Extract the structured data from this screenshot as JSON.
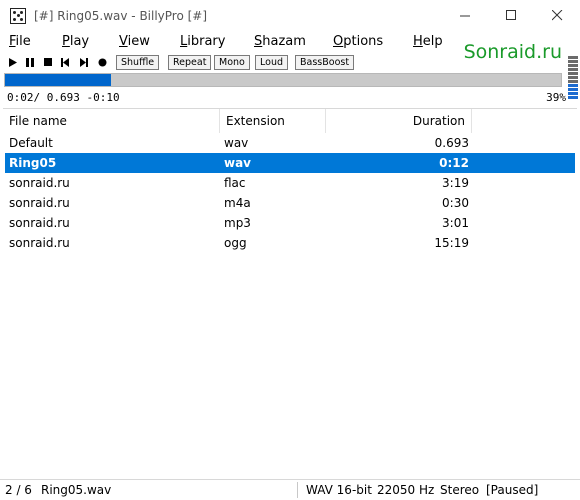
{
  "window": {
    "title": "[#] Ring05.wav - BillyPro [#]",
    "controls": {
      "minimize": "—",
      "maximize": "☐",
      "close": "✕"
    }
  },
  "menu": {
    "items": [
      {
        "label": "File",
        "underline": "F",
        "rest": "ile"
      },
      {
        "label": "Play",
        "underline": "P",
        "rest": "lay"
      },
      {
        "label": "View",
        "underline": "V",
        "rest": "iew"
      },
      {
        "label": "Library",
        "underline": "L",
        "rest": "ibrary"
      },
      {
        "label": "Shazam",
        "underline": "S",
        "rest": "hazam"
      },
      {
        "label": "Options",
        "underline": "O",
        "rest": "ptions"
      },
      {
        "label": "Help",
        "underline": "H",
        "rest": "elp"
      }
    ],
    "brand": "Sonraid.ru"
  },
  "toolbar": {
    "icons": [
      "play-icon",
      "pause-icon",
      "stop-icon",
      "previous-icon",
      "next-icon",
      "record-icon"
    ],
    "buttons": [
      "Shuffle",
      "Repeat",
      "Mono",
      "Loud",
      "BassBoost"
    ]
  },
  "playback": {
    "progress_fraction": 0.19,
    "time_text": "0:02/ 0.693  -0:10",
    "volume_text": "39%"
  },
  "table": {
    "columns": [
      "File name",
      "Extension",
      "Duration"
    ],
    "rows": [
      {
        "name": "Default",
        "ext": "wav",
        "duration": "0.693",
        "selected": false
      },
      {
        "name": "Ring05",
        "ext": "wav",
        "duration": "0:12",
        "selected": true
      },
      {
        "name": "sonraid.ru",
        "ext": "flac",
        "duration": "3:19",
        "selected": false
      },
      {
        "name": "sonraid.ru",
        "ext": "m4a",
        "duration": "0:30",
        "selected": false
      },
      {
        "name": "sonraid.ru",
        "ext": "mp3",
        "duration": "3:01",
        "selected": false
      },
      {
        "name": "sonraid.ru",
        "ext": "ogg",
        "duration": "15:19",
        "selected": false
      }
    ]
  },
  "status": {
    "position": "2 / 6",
    "file": "Ring05.wav",
    "format": "WAV 16-bit",
    "rate": "22050 Hz",
    "channels": "Stereo",
    "state": "[Paused]"
  },
  "colors": {
    "accent": "#0078d7",
    "progress": "#0066cc",
    "brand": "#1a9a2a"
  }
}
